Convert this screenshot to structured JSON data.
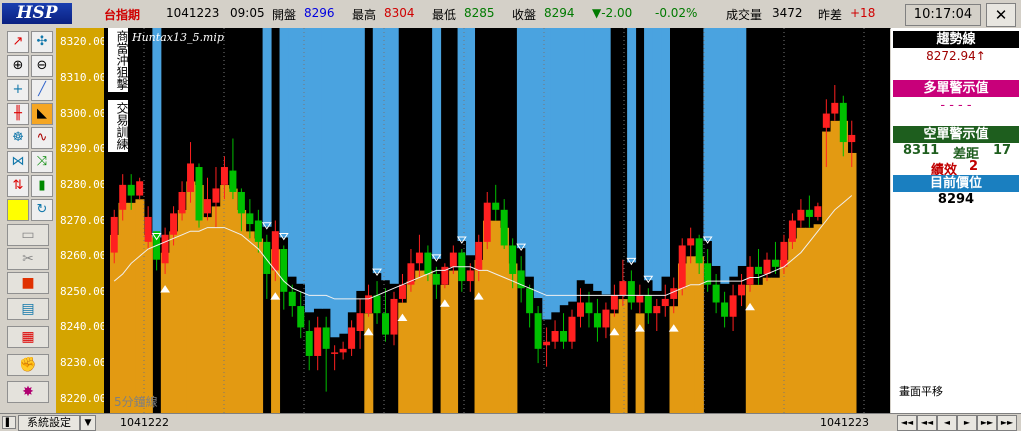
{
  "app": {
    "logo": "HSP"
  },
  "quote": {
    "symbol": "台指期",
    "date": "1041223",
    "time": "09:05",
    "open_label": "開盤",
    "open": "8296",
    "high_label": "最高",
    "high": "8304",
    "low_label": "最低",
    "low": "8285",
    "close_label": "收盤",
    "close": "8294",
    "change": "▼-2.00",
    "change_pct": "-0.02%",
    "volume_label": "成交量",
    "volume": "3472",
    "prev_label": "昨差",
    "prev_diff": "+18"
  },
  "clock": "10:17:04",
  "close_icon": "close-x-icon",
  "chart_labels": {
    "file": "Huntax13_5.mip",
    "vertical_tag_1": "商當沖狙擊",
    "vertical_tag_2": "交易訓練",
    "period": "5分鐘線"
  },
  "side_panel": {
    "trend_title": "趨勢線",
    "trend_value": "8272.94↑",
    "long_title": "多單警示值",
    "long_value": "- - - -",
    "short_title": "空單警示值",
    "short_value": "8311",
    "short_diff_label": "差距",
    "short_diff": "17",
    "perf_label": "績效",
    "perf_value": "2",
    "current_title": "目前價位",
    "current_value": "8294",
    "footer_note": "畫面平移"
  },
  "bottom_bar": {
    "settings_label": "系統設定",
    "start_date": "1041222",
    "end_date": "1041223"
  },
  "nav_buttons": [
    "◄◄",
    "◄◄",
    "◄",
    "►",
    "►►",
    "►►"
  ],
  "colors": {
    "up": "#ff2020",
    "down": "#00c000",
    "bull_zone": "#e39a12",
    "bear_zone": "#4aa3e0",
    "accent_blue": "#1a7fc0",
    "accent_pink": "#c8007a",
    "accent_green": "#1e5e1e"
  },
  "chart_data": {
    "type": "candlestick",
    "yticks": [
      "8320.00",
      "8310.00",
      "8300.00",
      "8290.00",
      "8280.00",
      "8270.00",
      "8260.00",
      "8250.00",
      "8240.00",
      "8230.00",
      "8220.00"
    ],
    "ylim": [
      8216,
      8324
    ],
    "candles": [
      [
        8261,
        8273,
        8258,
        8271
      ],
      [
        8273,
        8283,
        8270,
        8280
      ],
      [
        8280,
        8283,
        8273,
        8277
      ],
      [
        8277,
        8282,
        8276,
        8281
      ],
      [
        8264,
        8274,
        8262,
        8271
      ],
      [
        8267,
        8263,
        8256,
        8259
      ],
      [
        8258,
        8268,
        8255,
        8266
      ],
      [
        8266,
        8274,
        8263,
        8272
      ],
      [
        8272,
        8281,
        8270,
        8278
      ],
      [
        8278,
        8292,
        8275,
        8286
      ],
      [
        8285,
        8286,
        8268,
        8270
      ],
      [
        8272,
        8282,
        8270,
        8276
      ],
      [
        8275,
        8285,
        8268,
        8279
      ],
      [
        8280,
        8288,
        8276,
        8285
      ],
      [
        8284,
        8293,
        8276,
        8278
      ],
      [
        8278,
        8279,
        8267,
        8272
      ],
      [
        8272,
        8276,
        8265,
        8269
      ],
      [
        8270,
        8273,
        8261,
        8264
      ],
      [
        8264,
        8266,
        8248,
        8255
      ],
      [
        8256,
        8270,
        8253,
        8267
      ],
      [
        8262,
        8263,
        8245,
        8250
      ],
      [
        8250,
        8252,
        8243,
        8246
      ],
      [
        8246,
        8250,
        8237,
        8240
      ],
      [
        8239,
        8242,
        8228,
        8232
      ],
      [
        8232,
        8243,
        8228,
        8240
      ],
      [
        8240,
        8243,
        8222,
        8234
      ],
      [
        8233,
        8235,
        8228,
        8233
      ],
      [
        8233,
        8236,
        8231,
        8234
      ],
      [
        8234,
        8242,
        8232,
        8240
      ],
      [
        8239,
        8248,
        8234,
        8244
      ],
      [
        8244,
        8252,
        8243,
        8249
      ],
      [
        8249,
        8253,
        8241,
        8244
      ],
      [
        8244,
        8251,
        8236,
        8238
      ],
      [
        8238,
        8250,
        8235,
        8248
      ],
      [
        8248,
        8255,
        8247,
        8252
      ],
      [
        8252,
        8262,
        8250,
        8258
      ],
      [
        8258,
        8266,
        8254,
        8261
      ],
      [
        8261,
        8263,
        8253,
        8255
      ],
      [
        8255,
        8257,
        8248,
        8252
      ],
      [
        8252,
        8258,
        8251,
        8257
      ],
      [
        8257,
        8263,
        8255,
        8261
      ],
      [
        8261,
        8262,
        8250,
        8253
      ],
      [
        8253,
        8258,
        8250,
        8256
      ],
      [
        8256,
        8266,
        8253,
        8264
      ],
      [
        8264,
        8278,
        8262,
        8275
      ],
      [
        8275,
        8280,
        8270,
        8273
      ],
      [
        8273,
        8276,
        8262,
        8263
      ],
      [
        8263,
        8265,
        8251,
        8255
      ],
      [
        8256,
        8260,
        8247,
        8251
      ],
      [
        8251,
        8252,
        8240,
        8244
      ],
      [
        8244,
        8246,
        8230,
        8234
      ],
      [
        8235,
        8240,
        8229,
        8236
      ],
      [
        8236,
        8242,
        8234,
        8239
      ],
      [
        8239,
        8244,
        8234,
        8236
      ],
      [
        8236,
        8245,
        8234,
        8243
      ],
      [
        8243,
        8251,
        8240,
        8247
      ],
      [
        8247,
        8250,
        8240,
        8244
      ],
      [
        8244,
        8248,
        8236,
        8240
      ],
      [
        8240,
        8247,
        8237,
        8245
      ],
      [
        8245,
        8252,
        8243,
        8249
      ],
      [
        8249,
        8259,
        8246,
        8253
      ],
      [
        8253,
        8256,
        8245,
        8247
      ],
      [
        8247,
        8252,
        8244,
        8249
      ],
      [
        8249,
        8251,
        8241,
        8244
      ],
      [
        8244,
        8248,
        8239,
        8246
      ],
      [
        8246,
        8252,
        8243,
        8248
      ],
      [
        8248,
        8254,
        8244,
        8251
      ],
      [
        8251,
        8265,
        8249,
        8263
      ],
      [
        8263,
        8268,
        8258,
        8265
      ],
      [
        8265,
        8266,
        8255,
        8258
      ],
      [
        8258,
        8262,
        8250,
        8252
      ],
      [
        8252,
        8255,
        8244,
        8247
      ],
      [
        8247,
        8250,
        8240,
        8243
      ],
      [
        8243,
        8252,
        8239,
        8249
      ],
      [
        8249,
        8255,
        8246,
        8252
      ],
      [
        8252,
        8260,
        8250,
        8257
      ],
      [
        8257,
        8262,
        8252,
        8255
      ],
      [
        8255,
        8261,
        8253,
        8259
      ],
      [
        8259,
        8264,
        8255,
        8257
      ],
      [
        8257,
        8266,
        8255,
        8264
      ],
      [
        8264,
        8272,
        8262,
        8270
      ],
      [
        8270,
        8276,
        8268,
        8273
      ],
      [
        8273,
        8277,
        8268,
        8271
      ],
      [
        8271,
        8275,
        8270,
        8274
      ],
      [
        8296,
        8304,
        8285,
        8300
      ],
      [
        8300,
        8308,
        8298,
        8303
      ],
      [
        8303,
        8305,
        8288,
        8292
      ],
      [
        8292,
        8298,
        8285,
        8294
      ]
    ],
    "ma_line": [
      8253,
      8255,
      8258,
      8260,
      8262,
      8263,
      8264,
      8265,
      8266,
      8267,
      8267,
      8268,
      8268,
      8268,
      8267,
      8266,
      8264,
      8262,
      8259,
      8256,
      8253,
      8251,
      8250,
      8249,
      8249,
      8249,
      8248,
      8248,
      8248,
      8248,
      8248,
      8249,
      8250,
      8251,
      8252,
      8253,
      8254,
      8255,
      8256,
      8256,
      8257,
      8257,
      8257,
      8256,
      8256,
      8255,
      8254,
      8253,
      8252,
      8251,
      8250,
      8249,
      8249,
      8249,
      8249,
      8249,
      8249,
      8249,
      8249,
      8249,
      8249,
      8249,
      8249,
      8249,
      8249,
      8249,
      8250,
      8251,
      8252,
      8252,
      8253,
      8253,
      8253,
      8253,
      8253,
      8254,
      8254,
      8255,
      8256,
      8257,
      8259,
      8261,
      8264,
      8267,
      8270,
      8273,
      8275,
      8277
    ]
  }
}
